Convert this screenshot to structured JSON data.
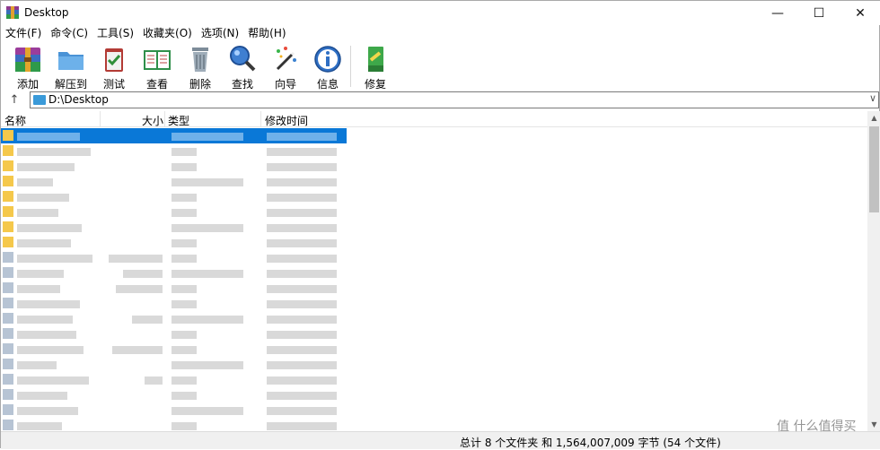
{
  "window": {
    "title": "Desktop",
    "controls": {
      "minimize": "—",
      "maximize": "☐",
      "close": "✕"
    }
  },
  "menu": [
    "文件(F)",
    "命令(C)",
    "工具(S)",
    "收藏夹(O)",
    "选项(N)",
    "帮助(H)"
  ],
  "toolbar": {
    "buttons": [
      {
        "label": "添加",
        "icon": "add-archive-icon"
      },
      {
        "label": "解压到",
        "icon": "extract-folder-icon"
      },
      {
        "label": "测试",
        "icon": "test-clipboard-icon"
      },
      {
        "label": "查看",
        "icon": "view-book-icon"
      },
      {
        "label": "删除",
        "icon": "delete-trash-icon"
      },
      {
        "label": "查找",
        "icon": "find-magnifier-icon"
      },
      {
        "label": "向导",
        "icon": "wizard-wand-icon"
      },
      {
        "label": "信息",
        "icon": "info-icon"
      },
      {
        "label": "修复",
        "icon": "repair-book-icon"
      }
    ]
  },
  "address": {
    "path": "D:\\Desktop",
    "up_glyph": "↑",
    "dropdown_glyph": "∨"
  },
  "columns": {
    "name": "名称",
    "size": "大小",
    "type": "类型",
    "modified": "修改时间"
  },
  "list": {
    "row_count": 20,
    "selected_row": 0
  },
  "status": {
    "text": "总计 8 个文件夹 和 1,564,007,009 字节 (54 个文件)"
  },
  "watermark": "值 什么值得买",
  "colors": {
    "selection": "#0a78d7",
    "folder": "#f5c84b",
    "address_folder": "#3a9ad9"
  }
}
